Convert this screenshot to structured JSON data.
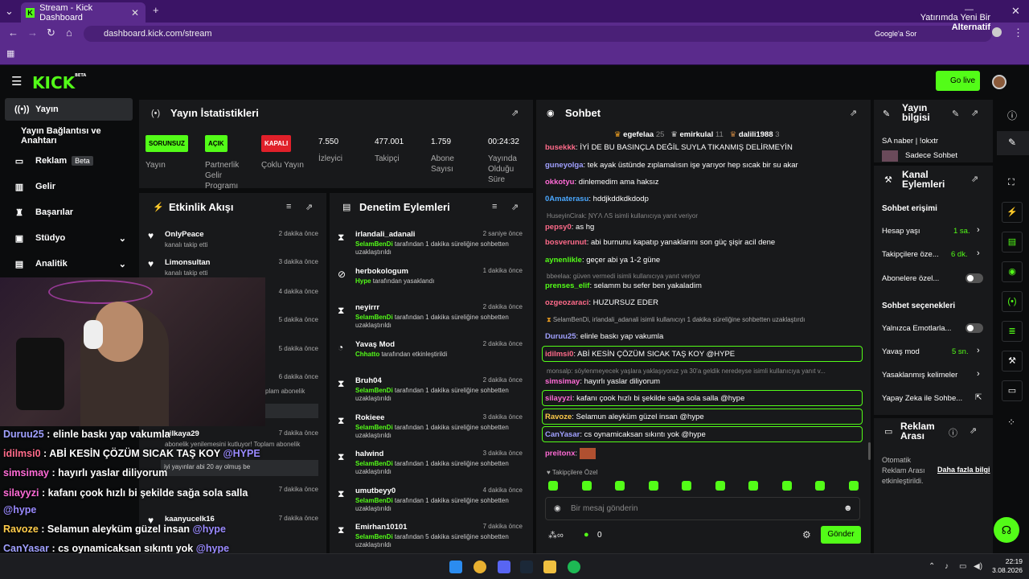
{
  "browser": {
    "tab_title": "Stream - Kick Dashboard",
    "url": "dashboard.kick.com/stream",
    "google_label": "Google'a Sor",
    "notif_line1": "Yatırımda Yeni Bir",
    "notif_line2": "Alternatif"
  },
  "header": {
    "logo": "KICK",
    "logo_sup": "BETA",
    "go_live": "Go live"
  },
  "sidebar": [
    {
      "label": "Yayın",
      "icon": "broadcast-icon"
    },
    {
      "label": "Yayın Bağlantısı ve Anahtarı",
      "icon": ""
    },
    {
      "label": "Reklam",
      "icon": "ad-icon",
      "badge": "Beta"
    },
    {
      "label": "Gelir",
      "icon": "chart-icon"
    },
    {
      "label": "Başarılar",
      "icon": "trophy-icon"
    },
    {
      "label": "Stüdyo",
      "icon": "studio-icon"
    },
    {
      "label": "Analitik",
      "icon": "analytics-icon"
    }
  ],
  "stats": {
    "title": "Yayın İstatistikleri",
    "items": [
      {
        "badge": "SORUNSUZ",
        "label": "Yayın",
        "badge_color": "#53fc18"
      },
      {
        "badge": "AÇIK",
        "label": "Partnerlik Gelir Programı",
        "badge_color": "#53fc18"
      },
      {
        "badge": "KAPALI",
        "label": "Çoklu Yayın",
        "badge_color": "#e0202a"
      },
      {
        "value": "7.550",
        "label": "İzleyici"
      },
      {
        "value": "477.001",
        "label": "Takipçi"
      },
      {
        "value": "1.759",
        "label": "Abone Sayısı"
      },
      {
        "value": "00:24:32",
        "label": "Yayında Olduğu Süre"
      }
    ]
  },
  "activity": {
    "title": "Etkinlik Akışı",
    "rows": [
      {
        "name": "OnlyPeace",
        "sub": "kanalı takip etti",
        "time": "2 dakika önce"
      },
      {
        "name": "Limonsultan",
        "sub": "kanalı takip etti",
        "time": "3 dakika önce"
      },
      {
        "time": "4 dakika önce"
      },
      {
        "time": "5 dakika önce"
      },
      {
        "time": "5 dakika önce"
      },
      {
        "time": "6 dakika önce",
        "sub": "plam abonelik"
      },
      {
        "name": "nilkaya29",
        "time": "7 dakika önce",
        "sub": "abonelik yenilemesini kutluyor! Toplam abonelik"
      },
      {
        "sub": "iyi yayınlar abi 20 ay olmuş be"
      },
      {
        "time": "7 dakika önce"
      },
      {
        "name": "kaanyucelk16",
        "time": "7 dakika önce"
      }
    ]
  },
  "moderation": {
    "title": "Denetim Eylemleri",
    "rows": [
      {
        "icon": "hourglass-icon",
        "name": "irlandali_adanali",
        "time": "2 saniye önce",
        "actor": "SelamBenDi",
        "text": "tarafından 1 dakika süreliğine sohbetten uzaklaştırıldı"
      },
      {
        "icon": "ban-icon",
        "name": "herbokologum",
        "time": "1 dakika önce",
        "actor": "Hype",
        "text": "tarafından yasaklandı"
      },
      {
        "icon": "hourglass-icon",
        "name": "neyirrr",
        "time": "2 dakika önce",
        "actor": "SelamBenDi",
        "text": "tarafından 1 dakika süreliğine sohbetten uzaklaştırıldı"
      },
      {
        "icon": "slow-icon",
        "name": "Yavaş Mod",
        "time": "2 dakika önce",
        "actor": "Chhatto",
        "text": "tarafından etkinleştirildi"
      },
      {
        "icon": "hourglass-icon",
        "name": "Bruh04",
        "time": "2 dakika önce",
        "actor": "SelamBenDi",
        "text": "tarafından 1 dakika süreliğine sohbetten uzaklaştırıldı"
      },
      {
        "icon": "hourglass-icon",
        "name": "Rokieee",
        "time": "3 dakika önce",
        "actor": "SelamBenDi",
        "text": "tarafından 1 dakika süreliğine sohbetten uzaklaştırıldı"
      },
      {
        "icon": "hourglass-icon",
        "name": "halwind",
        "time": "3 dakika önce",
        "actor": "SelamBenDi",
        "text": "tarafından 1 dakika süreliğine sohbetten uzaklaştırıldı"
      },
      {
        "icon": "hourglass-icon",
        "name": "umutbeyy0",
        "time": "4 dakika önce",
        "actor": "SelamBenDi",
        "text": "tarafından 1 dakika süreliğine sohbetten uzaklaştırıldı"
      },
      {
        "icon": "hourglass-icon",
        "name": "Emirhan10101",
        "time": "7 dakika önce",
        "actor": "SelamBenDi",
        "text": "tarafından 5 dakika süreliğine sohbetten uzaklaştırıldı"
      }
    ]
  },
  "chat": {
    "title": "Sohbet",
    "top": [
      {
        "name": "egefelaa",
        "count": "25"
      },
      {
        "name": "emirkulal",
        "count": "11"
      },
      {
        "name": "dalili1988",
        "count": "3"
      }
    ],
    "messages": [
      {
        "user": "busekkk",
        "color": "#ff6b8a",
        "text": "İYİ DE BU BASINÇLA DEĞİL SUYLA TIKANMIŞ DELİRMEYİN"
      },
      {
        "user": "guneyolga",
        "color": "#a0a0ff",
        "text": "tek ayak üstünde zıplamalısın işe yarıyor hep sıcak bir su akar"
      },
      {
        "user": "okkotyu",
        "color": "#ff6bd6",
        "text": "dinlemedim ama haksız"
      },
      {
        "user": "0Amaterasu",
        "color": "#4aa8ff",
        "text": "hddjkddkdkdodp"
      },
      {
        "reply": "HuseyinCirak: ƝƳɅ ɅS isimli kullanıcıya yanıt veriyor"
      },
      {
        "user": "pepsy0",
        "color": "#ff6b8a",
        "text": "as hg"
      },
      {
        "user": "bosverunut",
        "color": "#ff6b8a",
        "text": "abi burnunu kapatıp yanaklarını son güç şişir acil dene"
      },
      {
        "user": "aynenlikle",
        "color": "#53fc18",
        "text": "geçer abi ya 1-2 güne"
      },
      {
        "reply": "bbeelaa: güven vermedi isimli kullanıcıya yanıt veriyor"
      },
      {
        "user": "prenses_elif",
        "color": "#53fc18",
        "text": "selamm bu sefer ben yakaladim"
      },
      {
        "user": "ozgeozaraci",
        "color": "#ff6b8a",
        "text": "HUZURSUZ EDER"
      },
      {
        "system": "SelamBenDi, irlandali_adanali isimli kullanıcıyı 1 dakika süreliğine sohbetten uzaklaştırdı"
      },
      {
        "user": "Duruu25",
        "color": "#a0a0ff",
        "text": "elinle baskı yap vakumla"
      },
      {
        "user": "idilmsi0",
        "color": "#ff6b8a",
        "text": "ABİ KESİN ÇÖZÜM SICAK TAŞ KOY @HYPE",
        "hl": true
      },
      {
        "reply": "monsalp: söylenmeyecek yaşlara yaklaşıyoruz ya 30'a geldik neredeyse isimli kullanıcıya yanıt v..."
      },
      {
        "user": "simsimay",
        "color": "#ff6bd6",
        "text": "hayırlı yaslar diliyorum"
      },
      {
        "user": "silayyzi",
        "color": "#ff6bd6",
        "text": "kafanı çook hızlı bi şekilde sağa sola salla @hype",
        "hl": true
      },
      {
        "user": "Ravoze",
        "color": "#ffcc4a",
        "text": "Selamun aleyküm güzel insan @hype",
        "hl": true
      },
      {
        "user": "CanYasar",
        "color": "#a0a0ff",
        "text": "cs oynamicaksan sıkıntı yok @hype",
        "hl": true
      },
      {
        "user": "preitonx",
        "color": "#ff6bd6",
        "text": ""
      }
    ],
    "follow_note": "Takipçilere Özel",
    "input_placeholder": "Bir mesaj gönderin",
    "points": "0",
    "send": "Gönder"
  },
  "info": {
    "title": "Yayın bilgisi",
    "stream_title": "SA naber | !okxtr",
    "mode": "Sadece Sohbet"
  },
  "channel": {
    "title": "Kanal Eylemleri",
    "access": "Sohbet erişimi",
    "rows": [
      {
        "label": "Hesap yaşı",
        "value": "1 sa."
      },
      {
        "label": "Takipçilere öze...",
        "value": "6 dk."
      },
      {
        "label": "Abonelere özel...",
        "toggle": true
      }
    ],
    "options": "Sohbet seçenekleri",
    "opt_rows": [
      {
        "label": "Yalnızca Emotlarla...",
        "toggle": true
      },
      {
        "label": "Yavaş mod",
        "value": "5 sn."
      },
      {
        "label": "Yasaklanmış kelimeler"
      },
      {
        "label": "Yapay Zeka ile Sohbe..."
      }
    ]
  },
  "ads": {
    "title": "Reklam Arası",
    "text1": "Otomatik",
    "text2": "Reklam Arası",
    "text3": "etkinleştirildi.",
    "link": "Daha fazla bilgi"
  },
  "overlay": [
    {
      "user": "Duruu25",
      "color": "#a0a0ff",
      "text": "elinle baskı yap vakumla"
    },
    {
      "user": "idilmsi0",
      "color": "#ff6b8a",
      "text": "ABİ KESİN ÇÖZÜM SICAK TAŞ KOY",
      "tag": "@HYPE"
    },
    {
      "user": "simsimay",
      "color": "#ff6bd6",
      "text": "hayırlı yaslar diliyorum"
    },
    {
      "user": "silayyzi",
      "color": "#ff6bd6",
      "text": "kafanı çook hızlı bi şekilde sağa sola salla"
    },
    {
      "tag": "@hype"
    },
    {
      "user": "Ravoze",
      "color": "#ffcc4a",
      "text": "Selamun aleyküm güzel insan",
      "tag": "@hype"
    },
    {
      "user": "CanYasar",
      "color": "#a0a0ff",
      "text": "cs oynamicaksan sıkıntı yok",
      "tag": "@hype"
    },
    {
      "user": "preitonx",
      "color": "#ff6bd6",
      "text": ""
    }
  ],
  "taskbar": {
    "time": "22:19",
    "date": "3.08.2026"
  }
}
